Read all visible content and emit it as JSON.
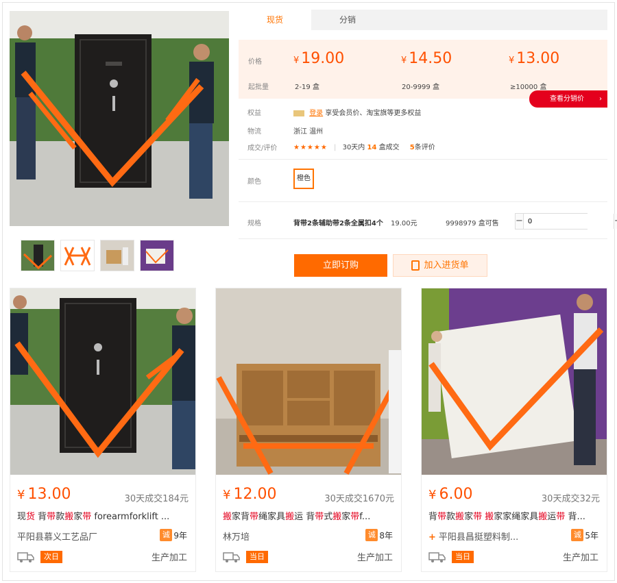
{
  "tabs": [
    {
      "label": "现货"
    },
    {
      "label": "分销"
    }
  ],
  "pricing": {
    "price_label": "价格",
    "moq_label": "起批量",
    "tiers": [
      {
        "price": "19.00",
        "qty": "2-19 盒"
      },
      {
        "price": "14.50",
        "qty": "20-9999 盒"
      },
      {
        "price": "13.00",
        "qty": "≥10000 盒"
      }
    ],
    "currency": "¥",
    "distributor_button": "查看分销价"
  },
  "info": {
    "rights_label": "权益",
    "rights_tag": "登录",
    "rights_text": "享受会员价、淘宝旗等更多权益",
    "logistics_label": "物流",
    "logistics_value": "浙江 温州",
    "deals_label": "成交/评价",
    "stars": "★★★★★",
    "deals_prefix": "30天内",
    "deals_count": "14",
    "deals_unit": "盒成交",
    "reviews_count": "5",
    "reviews_unit": "条评价"
  },
  "color": {
    "label": "颜色",
    "value": "橙色"
  },
  "spec": {
    "label": "规格",
    "name": "背带2条辅助带2条全属扣4个",
    "price": "19.00元",
    "stock": "9998979 盒可售",
    "quantity": "0",
    "minus": "−",
    "plus": "+"
  },
  "actions": {
    "order": "立即订购",
    "cart": "加入进货单"
  },
  "products": [
    {
      "price": "13.00",
      "sold": "30天成交184元",
      "title_parts": [
        [
          "现",
          ""
        ],
        [
          "货",
          "k"
        ],
        [
          " 背",
          ""
        ],
        [
          "带",
          "k"
        ],
        [
          "款",
          ""
        ],
        [
          "搬",
          "k"
        ],
        [
          "家",
          ""
        ],
        [
          "带",
          "k"
        ],
        [
          " forearmforklift ...",
          ""
        ]
      ],
      "shop": "平阳县慕义工艺品厂",
      "years": "9年",
      "badge": "诚",
      "delivery": "次日",
      "mfg": "生产加工"
    },
    {
      "price": "12.00",
      "sold": "30天成交1670元",
      "title_parts": [
        [
          "搬",
          "k"
        ],
        [
          "家背",
          ""
        ],
        [
          "带",
          "k"
        ],
        [
          "绳家具",
          ""
        ],
        [
          "搬",
          "k"
        ],
        [
          "运 背",
          ""
        ],
        [
          "带",
          "k"
        ],
        [
          "式",
          ""
        ],
        [
          "搬",
          "k"
        ],
        [
          "家",
          ""
        ],
        [
          "带",
          "k"
        ],
        [
          "f...",
          ""
        ]
      ],
      "shop": "林万培",
      "years": "8年",
      "badge": "诚",
      "delivery": "当日",
      "mfg": "生产加工"
    },
    {
      "price": "6.00",
      "sold": "30天成交32元",
      "title_parts": [
        [
          "背",
          ""
        ],
        [
          "带",
          "k"
        ],
        [
          "款",
          ""
        ],
        [
          "搬",
          "k"
        ],
        [
          "家",
          ""
        ],
        [
          "带",
          "k"
        ],
        [
          " ",
          ""
        ],
        [
          "搬",
          "k"
        ],
        [
          "家家绳家具",
          ""
        ],
        [
          "搬",
          "k"
        ],
        [
          "运",
          ""
        ],
        [
          "带",
          "k"
        ],
        [
          " 背...",
          ""
        ]
      ],
      "shop": "平阳县昌挺塑料制...",
      "years": "5年",
      "badge": "诚",
      "delivery": "当日",
      "mfg": "生产加工"
    }
  ],
  "colors": {
    "accent": "#ff7300",
    "price": "#ff5000",
    "red": "#e4001d",
    "strap": "#ff6a13"
  }
}
